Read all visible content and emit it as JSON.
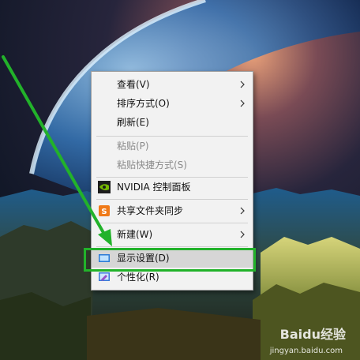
{
  "menu": {
    "items": [
      {
        "label": "查看(V)",
        "submenu": true,
        "disabled": false
      },
      {
        "label": "排序方式(O)",
        "submenu": true,
        "disabled": false
      },
      {
        "label": "刷新(E)",
        "submenu": false,
        "disabled": false
      },
      {
        "label": "粘贴(P)",
        "submenu": false,
        "disabled": true
      },
      {
        "label": "粘贴快捷方式(S)",
        "submenu": false,
        "disabled": true
      },
      {
        "label": "NVIDIA 控制面板",
        "submenu": false,
        "disabled": false,
        "icon": "nvidia-icon"
      },
      {
        "label": "共享文件夹同步",
        "submenu": true,
        "disabled": false,
        "icon": "sync-folder-icon"
      },
      {
        "label": "新建(W)",
        "submenu": true,
        "disabled": false
      },
      {
        "label": "显示设置(D)",
        "submenu": false,
        "disabled": false,
        "icon": "display-settings-icon",
        "highlighted": true
      },
      {
        "label": "个性化(R)",
        "submenu": false,
        "disabled": false,
        "icon": "personalize-icon"
      }
    ]
  },
  "watermark": {
    "brand": "Baidu经验",
    "url": "jingyan.baidu.com"
  },
  "colors": {
    "annotation": "#22b22a",
    "menu_bg": "#f2f2f2",
    "hover_bg": "#d6d6d6"
  }
}
